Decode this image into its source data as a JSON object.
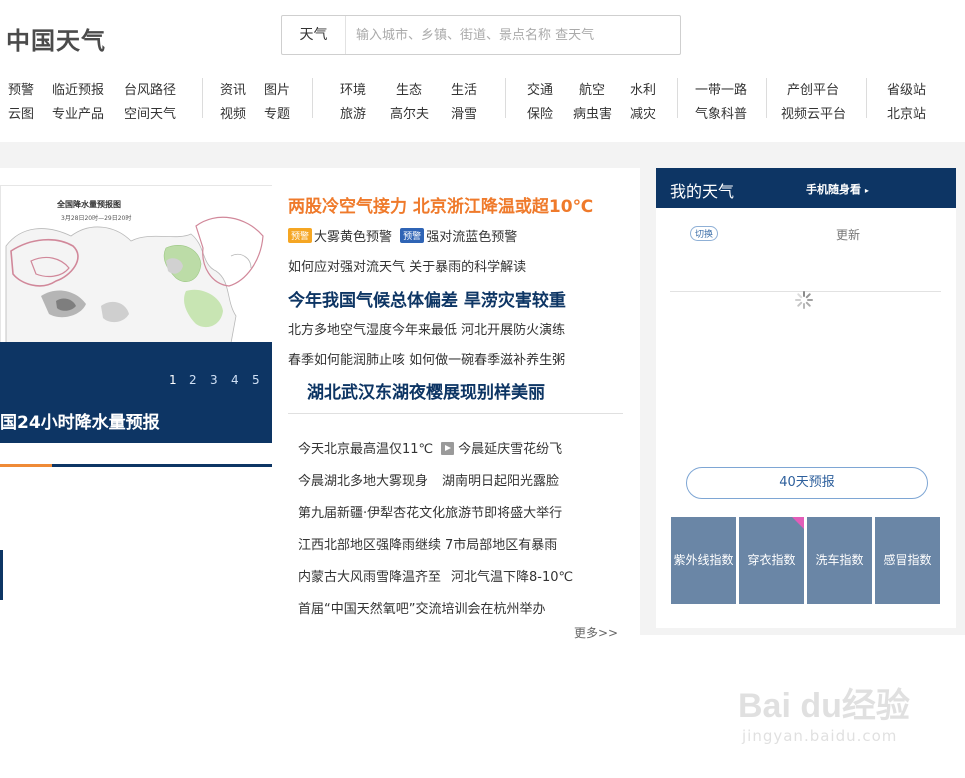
{
  "header": {
    "logo": "中国天气",
    "search_type": "天气",
    "search_placeholder": "输入城市、乡镇、街道、景点名称 查天气"
  },
  "nav": {
    "g1_r1": [
      "预警",
      "临近预报",
      "台风路径"
    ],
    "g1_r2": [
      "云图",
      "专业产品",
      "空间天气"
    ],
    "g2_r1": [
      "资讯",
      "图片"
    ],
    "g2_r2": [
      "视频",
      "专题"
    ],
    "g3_r1": [
      "环境",
      "生态",
      "生活"
    ],
    "g3_r2": [
      "旅游",
      "高尔夫",
      "滑雪"
    ],
    "g4_r1": [
      "交通",
      "航空",
      "水利"
    ],
    "g4_r2": [
      "保险",
      "病虫害",
      "减灾"
    ],
    "g5_r1": [
      "一带一路"
    ],
    "g5_r2": [
      "气象科普"
    ],
    "g6_r1": [
      "产创平台"
    ],
    "g6_r2": [
      "视频云平台"
    ],
    "g7_r1": [
      "省级站"
    ],
    "g7_r2": [
      "北京站"
    ]
  },
  "slider": {
    "map_title": "全国降水量预报图",
    "map_date": "3月28日20时—29日20时",
    "dots": [
      "1",
      "2",
      "3",
      "4",
      "5"
    ],
    "active_dot": 1,
    "caption": "国24小时降水量预报"
  },
  "news": {
    "main_headline": "两股冷空气接力 北京浙江降温或超10℃",
    "warn1_tag": "预警",
    "warn1_text": "大雾黄色预警",
    "warn2_tag": "预警",
    "warn2_text": "强对流蓝色预警",
    "line1": "如何应对强对流天气 关于暴雨的科学解读",
    "headline2": "今年我国气候总体偏差 旱涝灾害较重",
    "line2": "北方多地空气湿度今年来最低 河北开展防火演练",
    "line3": "春季如何能润肺止咳 如何做一碗春季滋补养生粥",
    "headline3": "湖北武汉东湖夜樱展现别样美丽",
    "list": [
      {
        "a": "今天北京最高温仅11℃",
        "b": "今晨延庆雪花纷飞",
        "video": true
      },
      {
        "a": "今晨湖北多地大雾现身",
        "b": "湖南明日起阳光露脸"
      },
      {
        "a": "第九届新疆·伊犁杏花文化旅游节即将盛大举行",
        "b": ""
      },
      {
        "a": "江西北部地区强降雨继续",
        "b": "7市局部地区有暴雨"
      },
      {
        "a": "内蒙古大风雨雪降温齐至",
        "b": "河北气温下降8-10℃"
      },
      {
        "a": "首届“中国天然氧吧”交流培训会在杭州举办",
        "b": ""
      }
    ],
    "more": "更多>>"
  },
  "my_weather": {
    "title": "我的天气",
    "mobile": "手机随身看",
    "switch": "切换",
    "update": "更新",
    "forecast40": "40天预报",
    "indexes": [
      "紫外线指数",
      "穿衣指数",
      "洗车指数",
      "感冒指数"
    ]
  },
  "watermark": {
    "main": "Bai du经验",
    "sub": "jingyan.baidu.com"
  },
  "colors": {
    "brand_navy": "#0d3564",
    "accent_orange": "#ef7a2b",
    "index_tile": "#6a86a6",
    "warn_yellow": "#f5a623",
    "warn_blue": "#2f64b5"
  }
}
